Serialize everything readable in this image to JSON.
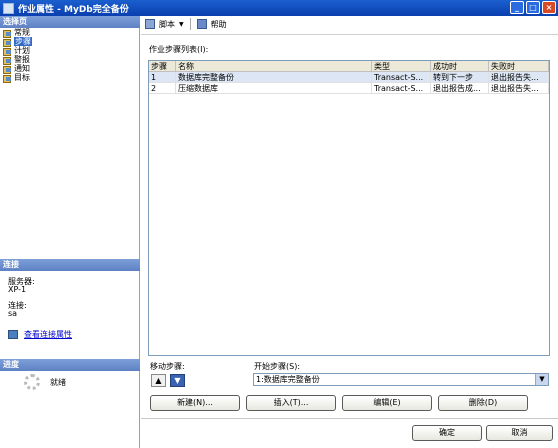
{
  "window": {
    "title": "作业属性 - MyDb完全备份",
    "buttons": {
      "minimize": "_",
      "maximize": "□",
      "close": "×"
    }
  },
  "left": {
    "select_page_header": "选择页",
    "pages": [
      "常规",
      "步骤",
      "计划",
      "警报",
      "通知",
      "目标"
    ],
    "selected_page_index": 1,
    "connection_header": "连接",
    "server_label": "服务器:",
    "server_value": "XP-1",
    "connection_label": "连接:",
    "connection_value": "sa",
    "view_connection_link": "查看连接属性",
    "progress_header": "进度",
    "progress_status": "就绪"
  },
  "toolbar": {
    "script_label": "脚本",
    "help_label": "帮助"
  },
  "steps": {
    "list_label": "作业步骤列表(I):",
    "columns": [
      "步骤",
      "名称",
      "类型",
      "成功时",
      "失败时"
    ],
    "rows": [
      {
        "step": "1",
        "name": "数据库完整备份",
        "type": "Transact-S...",
        "on_success": "转到下一步",
        "on_failure": "退出报告失..."
      },
      {
        "step": "2",
        "name": "压缩数据库",
        "type": "Transact-S...",
        "on_success": "退出报告成...",
        "on_failure": "退出报告失..."
      }
    ],
    "selected_row_index": 0
  },
  "move": {
    "label": "移动步骤:",
    "up_icon": "▲",
    "down_icon": "▼"
  },
  "start_step": {
    "label": "开始步骤(S):",
    "value": "1:数据库完整备份"
  },
  "actions": {
    "new": "新建(N)...",
    "insert": "插入(T)...",
    "edit": "编辑(E)",
    "delete": "删除(D)"
  },
  "footer": {
    "ok": "确定",
    "cancel": "取消"
  }
}
